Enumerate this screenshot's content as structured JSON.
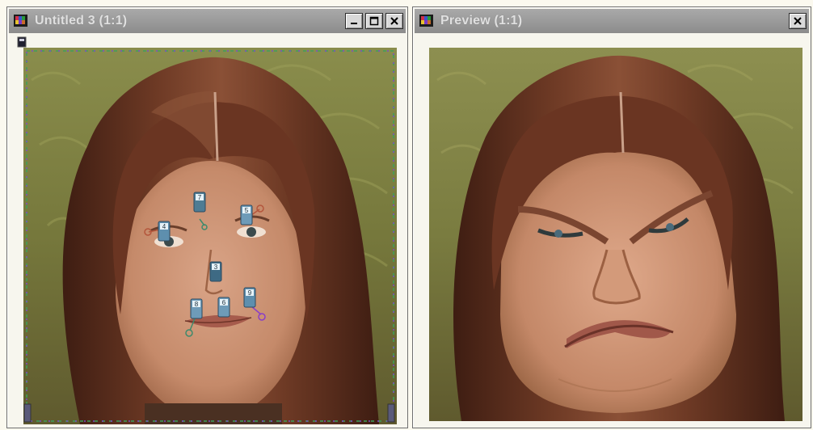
{
  "windows": [
    {
      "title": "Untitled 3 (1:1)",
      "buttons": [
        "minimize",
        "maximize",
        "close"
      ]
    },
    {
      "title": "Preview (1:1)",
      "buttons": [
        "close"
      ]
    }
  ],
  "markers": [
    "4",
    "7",
    "5",
    "3",
    "8",
    "6",
    "9"
  ],
  "colors": {
    "titlebar": "#8c8c8c",
    "window_bg": "#f7f6ee",
    "hair": "#5b2d1f",
    "skin": "#c98e6e",
    "background_grass": "#8a8a46"
  }
}
